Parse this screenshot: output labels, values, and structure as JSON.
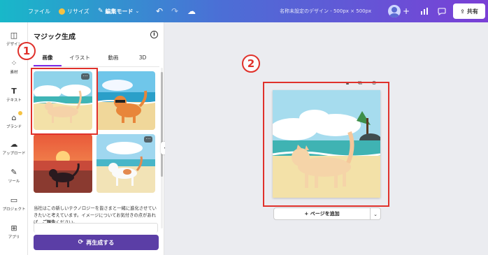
{
  "topbar": {
    "file_label": "ファイル",
    "resize_label": "リサイズ",
    "edit_mode_label": "編集モード",
    "design_title": "名称未設定のデザイン - 500px × 500px",
    "share_label": "共有",
    "add_icon_glyph": "+"
  },
  "rail": {
    "items": [
      {
        "label": "デザイン",
        "icon": "layout-icon"
      },
      {
        "label": "素材",
        "icon": "shapes-icon"
      },
      {
        "label": "テキスト",
        "icon": "text-icon"
      },
      {
        "label": "ブランド",
        "icon": "brand-icon"
      },
      {
        "label": "アップロード",
        "icon": "upload-cloud-icon"
      },
      {
        "label": "ツール",
        "icon": "pen-icon"
      },
      {
        "label": "プロジェクト",
        "icon": "folder-icon"
      },
      {
        "label": "アプリ",
        "icon": "apps-icon"
      }
    ]
  },
  "panel": {
    "title": "マジック生成",
    "tabs": [
      "画像",
      "イラスト",
      "動画",
      "3D"
    ],
    "active_tab": "画像",
    "notice_text": "当社はこの新しいテクノロジーを皆さまと一緒に進化させていきたいと考えています。イメージについてお気付きの点があれば、",
    "notice_link": "ご報告",
    "notice_tail": "ください。",
    "regenerate_label": "再生成する"
  },
  "canvas": {
    "add_page_label": "+ ページを追加"
  },
  "annotations": {
    "marker_1": "1",
    "marker_2": "2",
    "color": "#e0312b"
  },
  "colors": {
    "accent": "#7d2ae8",
    "regenerate_button": "#5b3ea6"
  }
}
